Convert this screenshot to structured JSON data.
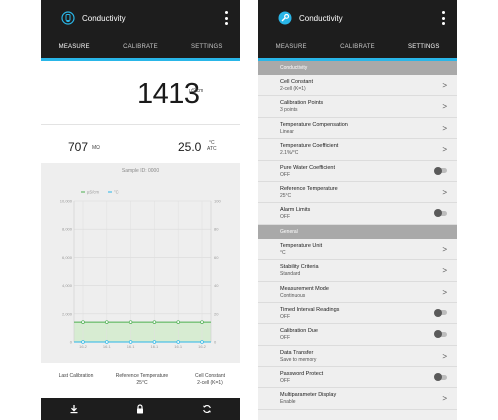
{
  "measure_screen": {
    "app_title": "Conductivity",
    "tabs": [
      {
        "label": "MEASURE",
        "active": true
      },
      {
        "label": "CALIBRATE",
        "active": false
      },
      {
        "label": "SETTINGS",
        "active": false
      }
    ],
    "reading": {
      "value": "1413",
      "unit": "µS/cm"
    },
    "resistivity": {
      "value": "707",
      "unit": "MΩ"
    },
    "temperature": {
      "value": "25.0",
      "unit_top": "°C",
      "unit_bottom": "ATC"
    },
    "sample_id": "Sample ID: 0000",
    "footer": {
      "last_calibration_label": "Last Calibration",
      "reference_temperature_label": "Reference Temperature",
      "reference_temperature_value": "25°C",
      "cell_constant_label": "Cell Constant",
      "cell_constant_value": "2-cell (K=1)"
    },
    "bottom_icons": [
      "download-icon",
      "lock-icon",
      "refresh-icon"
    ]
  },
  "chart_data": {
    "type": "line",
    "legend": [
      "µS/cm",
      "°C"
    ],
    "legend_placement": "top-left",
    "x": [
      "16.2",
      "16.1",
      "16.1",
      "16.1",
      "16.1",
      "16.2"
    ],
    "series": [
      {
        "name": "µS/cm",
        "values": [
          1413,
          1413,
          1413,
          1413,
          1413,
          1413
        ]
      },
      {
        "name": "°C",
        "values": [
          0,
          0,
          0,
          0,
          0,
          0
        ]
      }
    ],
    "y_left_ticks": [
      "10,000",
      "8,000",
      "6,000",
      "4,000",
      "2,000",
      "0"
    ],
    "y_right_ticks": [
      "100",
      "80",
      "60",
      "40",
      "20",
      "0"
    ],
    "ylim_left": [
      0,
      10000
    ],
    "ylim_right": [
      0,
      100
    ],
    "grid": true,
    "colors": {
      "conductivity": "#4caf50",
      "temperature": "#29b6e8"
    }
  },
  "settings_screen": {
    "app_title": "Conductivity",
    "tabs": [
      {
        "label": "MEASURE",
        "active": false
      },
      {
        "label": "CALIBRATE",
        "active": false
      },
      {
        "label": "SETTINGS",
        "active": true
      }
    ],
    "sections": [
      {
        "header": "Conductivity",
        "items": [
          {
            "title": "Cell Constant",
            "value": "2-cell (K=1)",
            "control": "chevron"
          },
          {
            "title": "Calibration Points",
            "value": "3 points",
            "control": "chevron"
          },
          {
            "title": "Temperature Compensation",
            "value": "Linear",
            "control": "chevron"
          },
          {
            "title": "Temperature Coefficient",
            "value": "2.1%/°C",
            "control": "chevron"
          },
          {
            "title": "Pure Water Coefficient",
            "value": "OFF",
            "control": "toggle"
          },
          {
            "title": "Reference Temperature",
            "value": "25°C",
            "control": "chevron"
          },
          {
            "title": "Alarm Limits",
            "value": "OFF",
            "control": "toggle"
          }
        ]
      },
      {
        "header": "General",
        "items": [
          {
            "title": "Temperature Unit",
            "value": "°C",
            "control": "chevron"
          },
          {
            "title": "Stability Criteria",
            "value": "Standard",
            "control": "chevron"
          },
          {
            "title": "Measurement Mode",
            "value": "Continuous",
            "control": "chevron"
          },
          {
            "title": "Timed Interval Readings",
            "value": "OFF",
            "control": "toggle"
          },
          {
            "title": "Calibration Due",
            "value": "OFF",
            "control": "toggle"
          },
          {
            "title": "Data Transfer",
            "value": "Save to memory",
            "control": "chevron"
          },
          {
            "title": "Password Protect",
            "value": "OFF",
            "control": "toggle"
          },
          {
            "title": "Multiparameter Display",
            "value": "Enable",
            "control": "chevron"
          }
        ]
      }
    ]
  },
  "colors": {
    "appbar": "#1d1d1d",
    "accent": "#29b6e8",
    "section_header": "#a9a9a9",
    "list_background": "#efefef"
  }
}
